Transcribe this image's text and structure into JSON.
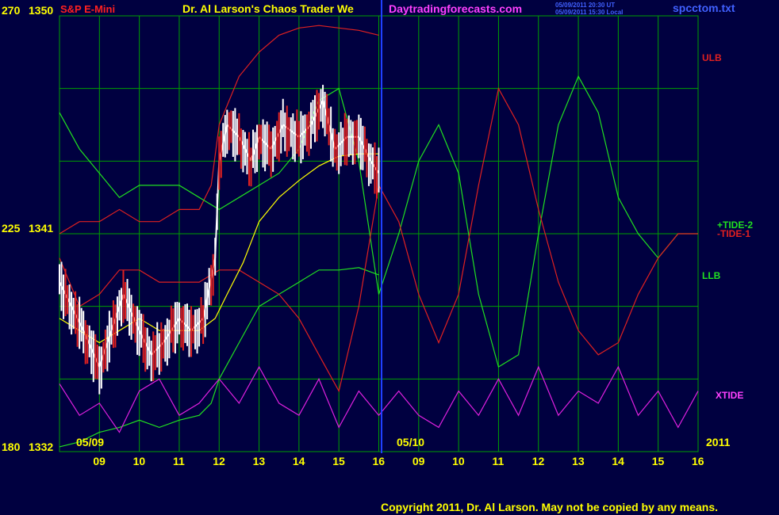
{
  "header": {
    "instrument": "S&P E-Mini",
    "title": "Dr. Al Larson's Chaos Trader We",
    "site": "Daytradingforecasts.com",
    "timestamp_ut": "05/09/2011 20:30 UT",
    "timestamp_local": "05/09/2011 15:30 Local",
    "filename": "spcctom.txt"
  },
  "y_axis": {
    "labels": [
      {
        "left": "270",
        "right": "1350"
      },
      {
        "left": "225",
        "right": "1341"
      },
      {
        "left": "180",
        "right": "1332"
      }
    ]
  },
  "x_axis": {
    "date_markers": [
      "05/09",
      "05/10"
    ],
    "year": "2011",
    "ticks": [
      "09",
      "10",
      "11",
      "12",
      "13",
      "14",
      "15",
      "16",
      "09",
      "10",
      "11",
      "12",
      "13",
      "14",
      "15",
      "16"
    ]
  },
  "series_labels": [
    "ULB",
    "+TIDE-2",
    "-TIDE-1",
    "LLB",
    "XTIDE"
  ],
  "footer": {
    "copyright": "Copyright 2011, Dr. Al Larson. May not be copied by any means."
  },
  "colors": {
    "background": "#000040",
    "grid": "#00a000",
    "red": "#e02020",
    "green": "#20e020",
    "magenta": "#e020e0",
    "blue": "#2040ff",
    "yellow": "#ffff00",
    "white": "#ffffff"
  },
  "chart_data": {
    "type": "line",
    "y_primary_range": [
      1332,
      1350
    ],
    "y_secondary_range": [
      180,
      270
    ],
    "grid": true,
    "series": [
      {
        "name": "ULB",
        "x": [
          8.0,
          8.5,
          9.0,
          9.5,
          10.0,
          10.5,
          11.0,
          11.5,
          11.8,
          12.0,
          12.5,
          13.0,
          13.5,
          14.0,
          14.5,
          15.0,
          15.5,
          16.0
        ],
        "y": [
          1341.0,
          1341.5,
          1341.5,
          1342.0,
          1341.5,
          1341.5,
          1342.0,
          1342.0,
          1343.0,
          1345.5,
          1347.5,
          1348.5,
          1349.2,
          1349.5,
          1349.6,
          1349.5,
          1349.4,
          1349.2
        ]
      },
      {
        "name": "LLB",
        "x": [
          8.0,
          8.5,
          9.0,
          9.5,
          10.0,
          10.5,
          11.0,
          11.5,
          11.8,
          12.0,
          12.5,
          13.0,
          13.5,
          14.0,
          14.5,
          15.0,
          15.5,
          16.0
        ],
        "y": [
          1332.2,
          1332.4,
          1332.8,
          1333.0,
          1333.3,
          1333.0,
          1333.3,
          1333.5,
          1334.0,
          1335.0,
          1336.5,
          1338.0,
          1338.5,
          1339.0,
          1339.5,
          1339.5,
          1339.6,
          1339.3
        ]
      },
      {
        "name": "+TIDE-2",
        "x": [
          8.0,
          8.5,
          9.0,
          9.5,
          10.0,
          10.5,
          11.0,
          11.5,
          12.0,
          12.5,
          13.0,
          13.5,
          14.0,
          14.5,
          15.0,
          15.5,
          16.0,
          16.5,
          17.0,
          17.5,
          18.0,
          18.5,
          19.0,
          19.5,
          20.0,
          20.5,
          21.0,
          21.5,
          22.0,
          22.5,
          23.0,
          23.5,
          24.0
        ],
        "y": [
          1346.0,
          1344.5,
          1343.5,
          1342.5,
          1343.0,
          1343.0,
          1343.0,
          1342.5,
          1342.0,
          1342.5,
          1343.0,
          1343.5,
          1344.5,
          1346.5,
          1347.0,
          1344.0,
          1338.5,
          1341.0,
          1344.0,
          1345.5,
          1343.5,
          1338.5,
          1335.5,
          1336.0,
          1341.0,
          1345.5,
          1347.5,
          1346.0,
          1342.5,
          1341.0,
          1340.0,
          1341.0,
          1341.0
        ]
      },
      {
        "name": "-TIDE-1",
        "x": [
          8.0,
          8.5,
          9.0,
          9.5,
          10.0,
          10.5,
          11.0,
          11.5,
          12.0,
          12.5,
          13.0,
          13.5,
          14.0,
          14.5,
          15.0,
          15.5,
          16.0,
          16.5,
          17.0,
          17.5,
          18.0,
          18.5,
          19.0,
          19.5,
          20.0,
          20.5,
          21.0,
          21.5,
          22.0,
          22.5,
          23.0,
          23.5,
          24.0
        ],
        "y": [
          1340.0,
          1338.0,
          1338.5,
          1339.5,
          1339.5,
          1339.0,
          1339.0,
          1339.0,
          1339.5,
          1339.5,
          1339.0,
          1338.5,
          1337.5,
          1336.0,
          1334.5,
          1338.0,
          1343.0,
          1341.5,
          1338.5,
          1336.5,
          1338.5,
          1343.0,
          1347.0,
          1345.5,
          1342.0,
          1339.0,
          1337.0,
          1336.0,
          1336.5,
          1338.5,
          1340.0,
          1341.0,
          1341.0
        ]
      },
      {
        "name": "XTIDE",
        "x": [
          8.0,
          8.5,
          9.0,
          9.5,
          10.0,
          10.5,
          11.0,
          11.5,
          12.0,
          12.5,
          13.0,
          13.5,
          14.0,
          14.5,
          15.0,
          15.5,
          16.0,
          16.5,
          17.0,
          17.5,
          18.0,
          18.5,
          19.0,
          19.5,
          20.0,
          20.5,
          21.0,
          21.5,
          22.0,
          22.5,
          23.0,
          23.5,
          24.0
        ],
        "y": [
          1334.8,
          1333.5,
          1334.0,
          1332.8,
          1334.5,
          1335.0,
          1333.5,
          1334.0,
          1335.0,
          1334.0,
          1335.5,
          1334.0,
          1333.5,
          1335.0,
          1333.0,
          1334.5,
          1333.5,
          1334.5,
          1333.5,
          1333.0,
          1334.5,
          1333.5,
          1335.0,
          1333.5,
          1335.5,
          1333.5,
          1334.5,
          1334.0,
          1335.5,
          1333.5,
          1334.5,
          1333.0,
          1334.5
        ]
      },
      {
        "name": "price",
        "x": [
          8.0,
          8.3,
          8.6,
          9.0,
          9.3,
          9.6,
          10.0,
          10.3,
          10.6,
          11.0,
          11.3,
          11.6,
          11.9,
          12.0,
          12.2,
          12.5,
          12.8,
          13.0,
          13.3,
          13.6,
          14.0,
          14.3,
          14.6,
          14.9,
          15.2,
          15.5,
          15.8,
          16.0
        ],
        "y": [
          1339.0,
          1338.0,
          1337.0,
          1335.5,
          1337.0,
          1338.5,
          1337.0,
          1336.0,
          1336.5,
          1337.5,
          1337.0,
          1337.5,
          1340.0,
          1344.0,
          1345.5,
          1345.0,
          1344.0,
          1345.0,
          1344.5,
          1345.5,
          1345.0,
          1345.5,
          1346.5,
          1344.5,
          1345.0,
          1345.0,
          1344.0,
          1343.5
        ]
      },
      {
        "name": "moving average",
        "x": [
          8.0,
          8.5,
          9.0,
          9.5,
          10.0,
          10.5,
          11.0,
          11.5,
          11.9,
          12.2,
          12.6,
          13.0,
          13.5,
          14.0,
          14.5,
          15.0,
          15.5,
          16.0
        ],
        "y": [
          1337.5,
          1337.0,
          1336.5,
          1337.0,
          1337.5,
          1337.0,
          1337.0,
          1337.0,
          1337.5,
          1338.5,
          1339.8,
          1341.5,
          1342.5,
          1343.2,
          1343.8,
          1344.2,
          1344.3,
          1344.3
        ]
      }
    ]
  }
}
